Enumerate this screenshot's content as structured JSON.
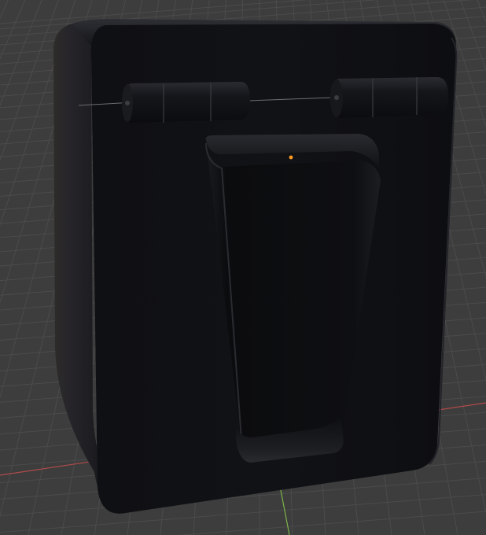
{
  "viewport": {
    "background_color": "#3d3d3d",
    "grid_color": "#4b4b4b",
    "x_axis_color": "#b04a4a",
    "y_axis_color": "#7db34a",
    "origin_marker_color": "#ff9a1f"
  },
  "object": {
    "body_color": "#101114",
    "parts": [
      "housing",
      "left-hinge",
      "right-hinge",
      "belt-clip"
    ]
  }
}
